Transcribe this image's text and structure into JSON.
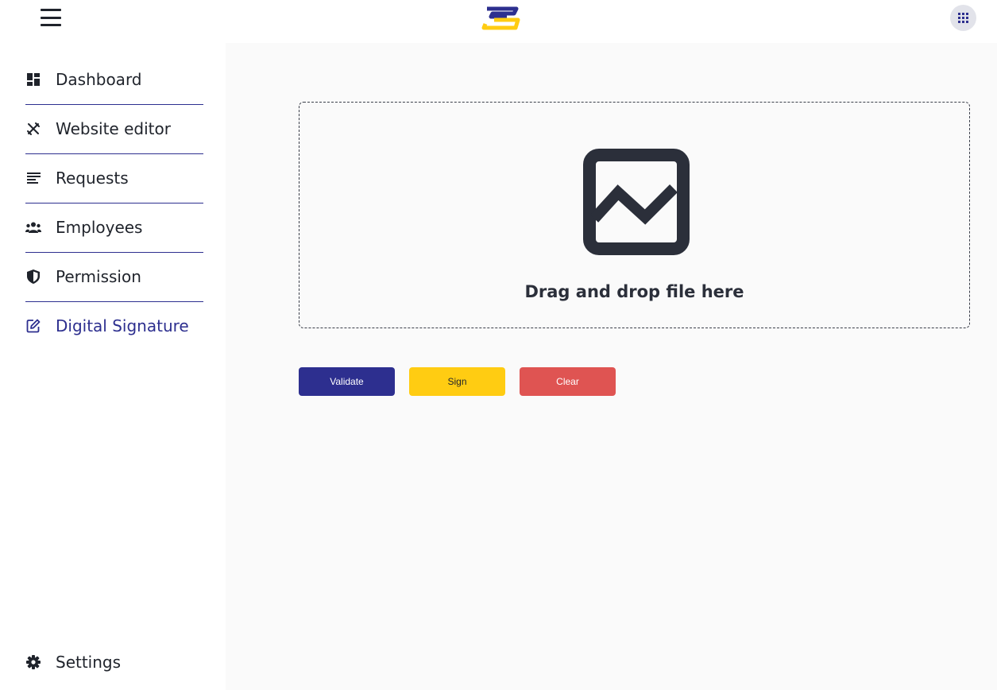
{
  "header": {
    "menu_icon": "hamburger-icon",
    "logo_icon": "app-logo",
    "apps_icon": "apps-grid-icon"
  },
  "sidebar": {
    "items": [
      {
        "label": "Dashboard",
        "icon": "dashboard-icon"
      },
      {
        "label": "Website editor",
        "icon": "design-tools-icon"
      },
      {
        "label": "Requests",
        "icon": "list-icon"
      },
      {
        "label": "Employees",
        "icon": "group-icon"
      },
      {
        "label": "Permission",
        "icon": "shield-icon"
      },
      {
        "label": "Digital Signature",
        "icon": "edit-document-icon",
        "active": true
      }
    ],
    "settings": {
      "label": "Settings",
      "icon": "gear-icon"
    }
  },
  "main": {
    "dropzone": {
      "text": "Drag and drop file here",
      "icon": "image-icon"
    },
    "buttons": {
      "validate": "Validate",
      "sign": "Sign",
      "clear": "Clear"
    }
  },
  "colors": {
    "primary": "#2d2f8f",
    "accent": "#ffcc12",
    "danger": "#df5452",
    "background": "#fafafa"
  }
}
